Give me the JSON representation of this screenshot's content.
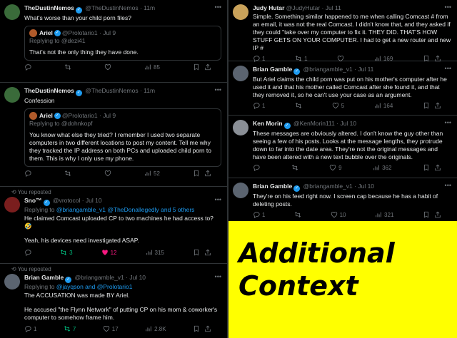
{
  "left_tweets": [
    {
      "name": "TheDustinNemos",
      "handle": "@TheDustinNemos",
      "time": "· 11m",
      "text": "What's worse than your child porn files?",
      "quote": {
        "name": "Ariel",
        "handle": "@Prolotario1",
        "time": "· Jul 9",
        "replying": "Replying to @dezi41",
        "text": "That's not the only thing they have done."
      },
      "views": "85"
    },
    {
      "name": "TheDustinNemos",
      "handle": "@TheDustinNemos",
      "time": "· 11m",
      "text": "Confession",
      "quote": {
        "name": "Ariel",
        "handle": "@Prolotario1",
        "time": "· Jul 9",
        "replying": "Replying to @dohnkopf",
        "text": "You know what else they tried? I remember I used two separate computers in two different locations to post my content. Tell me why they tracked the IP address on both PCs and uploaded child porn to them. This is why I only use my phone."
      },
      "views": "52"
    },
    {
      "reposted": "You reposted",
      "name": "Sno™",
      "handle": "@vrotocol",
      "time": "· Jul 10",
      "replying_prefix": "Replying to ",
      "replying_links": "@briangamble_v1 @TheDonallegedly and 5 others",
      "paragraphs": [
        "He claimed Comcast uploaded CP to two machines he had access to? 🤣",
        "Yeah, his devices need investigated ASAP."
      ],
      "retweets": "3",
      "likes": "12",
      "views": "315"
    },
    {
      "reposted": "You reposted",
      "name": "Brian Gamble",
      "handle": "@briangamble_v1",
      "time": "· Jul 10",
      "replying_prefix": "Replying to ",
      "replying_links": "@jayqson and @Prolotario1",
      "paragraphs": [
        "The ACCUSATION was made BY Ariel.",
        "He accused \"the Flynn Network\" of putting CP on his mom & coworker's computer to somehow frame him."
      ],
      "replies": "1",
      "retweets": "7",
      "likes": "17",
      "views": "2.8K"
    }
  ],
  "right_tweets": [
    {
      "name": "Judy Hutar",
      "handle": "@JudyHutar",
      "time": "· Jul 11",
      "text": "Simple. Something similar happened to me when calling Comcast # from an email, it was not the real Comcast. I didn't know that, and they asked if they could \"take over my computer to fix it. THEY DID. THAT'S HOW STUFF GETS ON YOUR COMPUTER. I had to get a new router and new IP #",
      "replies": "1",
      "retweets": "1",
      "views": "169"
    },
    {
      "name": "Brian Gamble",
      "handle": "@briangamble_v1",
      "time": "· Jul 11",
      "text": "But Ariel claims the child porn was put on his mother's computer after he used it and that his mother called Comcast after she found it, and that they removed it, so he can't use your case as an argument.",
      "replies": "1",
      "likes": "5",
      "views": "164"
    },
    {
      "name": "Ken Morin",
      "handle": "@KenMorin111",
      "time": "· Jul 10",
      "text": "These messages are obviously altered. I don't know the guy other than seeing a few of his posts. Looks at the message lengths, they protrude down to far into the date area. They're not the original messages and have been altered with a new text bubble over the originals.",
      "likes": "9",
      "views": "362"
    },
    {
      "name": "Brian Gamble",
      "handle": "@briangamble_v1",
      "time": "· Jul 10",
      "text": "They're on his feed right now. I screen cap because he has a habit of deleting posts.",
      "replies": "1",
      "likes": "10",
      "views": "321"
    }
  ],
  "context_panel": {
    "line1": "Additional",
    "line2": "Context"
  },
  "colors": {
    "background": "#000000",
    "text": "#e7e9ea",
    "muted": "#71767b",
    "link": "#1d9bf0",
    "verified": "#1d9bf0",
    "repost_green": "#00ba7c",
    "like_pink": "#f91880",
    "divider": "#2f3336",
    "context_yellow": "#ffff00"
  },
  "icons": [
    "reply-icon",
    "repost-icon",
    "like-icon",
    "views-icon",
    "bookmark-icon",
    "share-icon",
    "more-icon",
    "verified-icon"
  ]
}
